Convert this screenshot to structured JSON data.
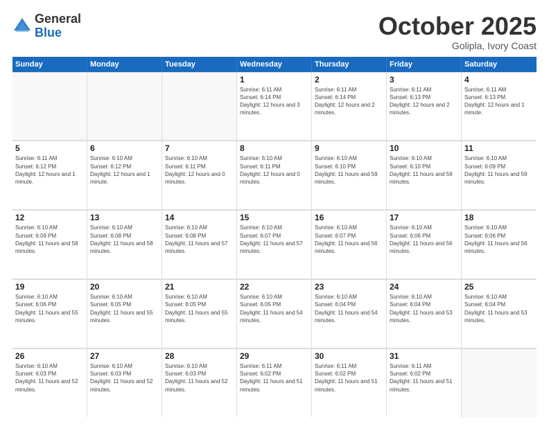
{
  "header": {
    "logo": {
      "general": "General",
      "blue": "Blue"
    },
    "title": "October 2025",
    "location": "Golipla, Ivory Coast"
  },
  "weekdays": [
    "Sunday",
    "Monday",
    "Tuesday",
    "Wednesday",
    "Thursday",
    "Friday",
    "Saturday"
  ],
  "weeks": [
    [
      {
        "day": "",
        "sunrise": "",
        "sunset": "",
        "daylight": "",
        "empty": true
      },
      {
        "day": "",
        "sunrise": "",
        "sunset": "",
        "daylight": "",
        "empty": true
      },
      {
        "day": "",
        "sunrise": "",
        "sunset": "",
        "daylight": "",
        "empty": true
      },
      {
        "day": "1",
        "sunrise": "Sunrise: 6:11 AM",
        "sunset": "Sunset: 6:14 PM",
        "daylight": "Daylight: 12 hours and 3 minutes.",
        "empty": false
      },
      {
        "day": "2",
        "sunrise": "Sunrise: 6:11 AM",
        "sunset": "Sunset: 6:14 PM",
        "daylight": "Daylight: 12 hours and 2 minutes.",
        "empty": false
      },
      {
        "day": "3",
        "sunrise": "Sunrise: 6:11 AM",
        "sunset": "Sunset: 6:13 PM",
        "daylight": "Daylight: 12 hours and 2 minutes.",
        "empty": false
      },
      {
        "day": "4",
        "sunrise": "Sunrise: 6:11 AM",
        "sunset": "Sunset: 6:13 PM",
        "daylight": "Daylight: 12 hours and 1 minute.",
        "empty": false
      }
    ],
    [
      {
        "day": "5",
        "sunrise": "Sunrise: 6:11 AM",
        "sunset": "Sunset: 6:12 PM",
        "daylight": "Daylight: 12 hours and 1 minute.",
        "empty": false
      },
      {
        "day": "6",
        "sunrise": "Sunrise: 6:10 AM",
        "sunset": "Sunset: 6:12 PM",
        "daylight": "Daylight: 12 hours and 1 minute.",
        "empty": false
      },
      {
        "day": "7",
        "sunrise": "Sunrise: 6:10 AM",
        "sunset": "Sunset: 6:11 PM",
        "daylight": "Daylight: 12 hours and 0 minutes.",
        "empty": false
      },
      {
        "day": "8",
        "sunrise": "Sunrise: 6:10 AM",
        "sunset": "Sunset: 6:11 PM",
        "daylight": "Daylight: 12 hours and 0 minutes.",
        "empty": false
      },
      {
        "day": "9",
        "sunrise": "Sunrise: 6:10 AM",
        "sunset": "Sunset: 6:10 PM",
        "daylight": "Daylight: 11 hours and 59 minutes.",
        "empty": false
      },
      {
        "day": "10",
        "sunrise": "Sunrise: 6:10 AM",
        "sunset": "Sunset: 6:10 PM",
        "daylight": "Daylight: 11 hours and 59 minutes.",
        "empty": false
      },
      {
        "day": "11",
        "sunrise": "Sunrise: 6:10 AM",
        "sunset": "Sunset: 6:09 PM",
        "daylight": "Daylight: 11 hours and 59 minutes.",
        "empty": false
      }
    ],
    [
      {
        "day": "12",
        "sunrise": "Sunrise: 6:10 AM",
        "sunset": "Sunset: 6:09 PM",
        "daylight": "Daylight: 11 hours and 58 minutes.",
        "empty": false
      },
      {
        "day": "13",
        "sunrise": "Sunrise: 6:10 AM",
        "sunset": "Sunset: 6:08 PM",
        "daylight": "Daylight: 11 hours and 58 minutes.",
        "empty": false
      },
      {
        "day": "14",
        "sunrise": "Sunrise: 6:10 AM",
        "sunset": "Sunset: 6:08 PM",
        "daylight": "Daylight: 11 hours and 57 minutes.",
        "empty": false
      },
      {
        "day": "15",
        "sunrise": "Sunrise: 6:10 AM",
        "sunset": "Sunset: 6:07 PM",
        "daylight": "Daylight: 11 hours and 57 minutes.",
        "empty": false
      },
      {
        "day": "16",
        "sunrise": "Sunrise: 6:10 AM",
        "sunset": "Sunset: 6:07 PM",
        "daylight": "Daylight: 11 hours and 56 minutes.",
        "empty": false
      },
      {
        "day": "17",
        "sunrise": "Sunrise: 6:10 AM",
        "sunset": "Sunset: 6:06 PM",
        "daylight": "Daylight: 11 hours and 56 minutes.",
        "empty": false
      },
      {
        "day": "18",
        "sunrise": "Sunrise: 6:10 AM",
        "sunset": "Sunset: 6:06 PM",
        "daylight": "Daylight: 11 hours and 56 minutes.",
        "empty": false
      }
    ],
    [
      {
        "day": "19",
        "sunrise": "Sunrise: 6:10 AM",
        "sunset": "Sunset: 6:06 PM",
        "daylight": "Daylight: 11 hours and 55 minutes.",
        "empty": false
      },
      {
        "day": "20",
        "sunrise": "Sunrise: 6:10 AM",
        "sunset": "Sunset: 6:05 PM",
        "daylight": "Daylight: 11 hours and 55 minutes.",
        "empty": false
      },
      {
        "day": "21",
        "sunrise": "Sunrise: 6:10 AM",
        "sunset": "Sunset: 6:05 PM",
        "daylight": "Daylight: 11 hours and 55 minutes.",
        "empty": false
      },
      {
        "day": "22",
        "sunrise": "Sunrise: 6:10 AM",
        "sunset": "Sunset: 6:05 PM",
        "daylight": "Daylight: 11 hours and 54 minutes.",
        "empty": false
      },
      {
        "day": "23",
        "sunrise": "Sunrise: 6:10 AM",
        "sunset": "Sunset: 6:04 PM",
        "daylight": "Daylight: 11 hours and 54 minutes.",
        "empty": false
      },
      {
        "day": "24",
        "sunrise": "Sunrise: 6:10 AM",
        "sunset": "Sunset: 6:04 PM",
        "daylight": "Daylight: 11 hours and 53 minutes.",
        "empty": false
      },
      {
        "day": "25",
        "sunrise": "Sunrise: 6:10 AM",
        "sunset": "Sunset: 6:04 PM",
        "daylight": "Daylight: 11 hours and 53 minutes.",
        "empty": false
      }
    ],
    [
      {
        "day": "26",
        "sunrise": "Sunrise: 6:10 AM",
        "sunset": "Sunset: 6:03 PM",
        "daylight": "Daylight: 11 hours and 52 minutes.",
        "empty": false
      },
      {
        "day": "27",
        "sunrise": "Sunrise: 6:10 AM",
        "sunset": "Sunset: 6:03 PM",
        "daylight": "Daylight: 11 hours and 52 minutes.",
        "empty": false
      },
      {
        "day": "28",
        "sunrise": "Sunrise: 6:10 AM",
        "sunset": "Sunset: 6:03 PM",
        "daylight": "Daylight: 11 hours and 52 minutes.",
        "empty": false
      },
      {
        "day": "29",
        "sunrise": "Sunrise: 6:11 AM",
        "sunset": "Sunset: 6:02 PM",
        "daylight": "Daylight: 11 hours and 51 minutes.",
        "empty": false
      },
      {
        "day": "30",
        "sunrise": "Sunrise: 6:11 AM",
        "sunset": "Sunset: 6:02 PM",
        "daylight": "Daylight: 11 hours and 51 minutes.",
        "empty": false
      },
      {
        "day": "31",
        "sunrise": "Sunrise: 6:11 AM",
        "sunset": "Sunset: 6:02 PM",
        "daylight": "Daylight: 11 hours and 51 minutes.",
        "empty": false
      },
      {
        "day": "",
        "sunrise": "",
        "sunset": "",
        "daylight": "",
        "empty": true
      }
    ]
  ]
}
